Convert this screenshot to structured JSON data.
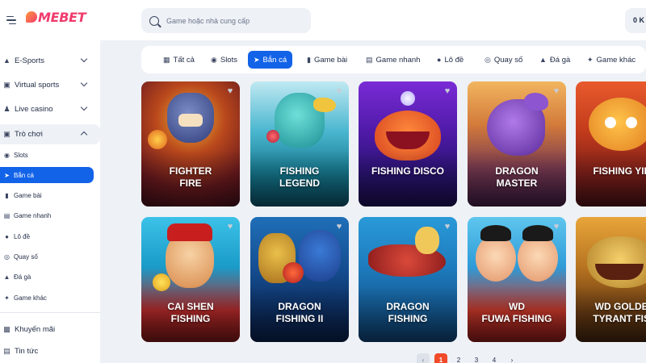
{
  "header": {
    "logo": "MEBET",
    "search_placeholder": "Game hoặc nhà cung cấp",
    "balance": "0 K"
  },
  "sidebar": {
    "sections": [
      {
        "label": "E-Sports",
        "icon": "gamepad-icon"
      },
      {
        "label": "Virtual sports",
        "icon": "virtual-sports-icon"
      },
      {
        "label": "Live casino",
        "icon": "live-casino-icon"
      },
      {
        "label": "Trò chơi",
        "icon": "games-icon"
      }
    ],
    "sub_items": [
      {
        "label": "Slots",
        "icon": "slots-icon"
      },
      {
        "label": "Bắn cá",
        "icon": "fish-icon"
      },
      {
        "label": "Game bài",
        "icon": "cards-icon"
      },
      {
        "label": "Game nhanh",
        "icon": "fast-game-icon"
      },
      {
        "label": "Lô đề",
        "icon": "lottery-ball-icon"
      },
      {
        "label": "Quay số",
        "icon": "dial-icon"
      },
      {
        "label": "Đá gà",
        "icon": "cockfight-icon"
      },
      {
        "label": "Game khác",
        "icon": "other-games-icon"
      }
    ],
    "bottom": [
      {
        "label": "Khuyến mãi",
        "icon": "promo-icon"
      },
      {
        "label": "Tin tức",
        "icon": "news-icon"
      }
    ]
  },
  "tabs": [
    {
      "label": "Tất cả",
      "icon": "grid-icon"
    },
    {
      "label": "Slots",
      "icon": "slots-icon"
    },
    {
      "label": "Bắn cá",
      "icon": "fish-icon"
    },
    {
      "label": "Game bài",
      "icon": "cards-icon"
    },
    {
      "label": "Game nhanh",
      "icon": "fast-game-icon"
    },
    {
      "label": "Lô đề",
      "icon": "lottery-ball-icon"
    },
    {
      "label": "Quay số",
      "icon": "dial-icon"
    },
    {
      "label": "Đá gà",
      "icon": "cockfight-icon"
    },
    {
      "label": "Game khác",
      "icon": "other-games-icon"
    }
  ],
  "games": [
    {
      "title": "FIGHTER\nFIRE"
    },
    {
      "title": "FISHING\nLEGEND"
    },
    {
      "title": "FISHING DISCO"
    },
    {
      "title": "DRAGON\nMASTER"
    },
    {
      "title": "FISHING YILU"
    },
    {
      "title": "CAI SHEN\nFISHING"
    },
    {
      "title": "DRAGON\nFISHING II"
    },
    {
      "title": "DRAGON\nFISHING"
    },
    {
      "title": "WD\nFUWA FISHING"
    },
    {
      "title": "WD GOLDEN\nTYRANT FISH"
    }
  ],
  "pagination": {
    "pages": [
      "1",
      "2",
      "3",
      "4"
    ],
    "current": "1"
  },
  "colors": {
    "accent": "#1263e8",
    "brand": "#f13b6c",
    "page_active": "#f04a28"
  }
}
